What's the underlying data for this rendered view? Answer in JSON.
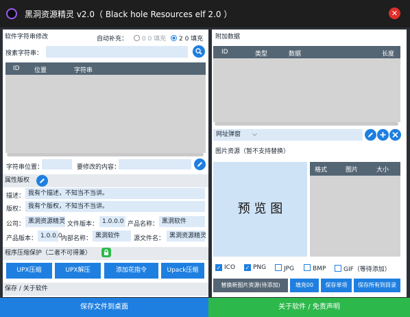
{
  "window": {
    "title": "黑洞资源精灵 v2.0（ Black hole Resources elf 2.0 ）",
    "close_glyph": "✕"
  },
  "strings": {
    "section": "软件字符串修改",
    "auto_fill_label": "自动补充：",
    "fill_00": "0 0 填充",
    "fill_20": "2 0 填充",
    "search_label": "搜素字符串：",
    "search_value": "",
    "columns": [
      "ID",
      "位置",
      "字符串"
    ],
    "pos_label": "字符串位置：",
    "pos_value": "",
    "edit_label": "要修改的内容：",
    "edit_value": ""
  },
  "props": {
    "section": "属性版权",
    "desc_label": "描述：",
    "desc_value": "我有个描述，不知当不当讲。",
    "copyright_label": "版权：",
    "copyright_value": "我有个版权，不知当不当讲。",
    "company_label": "公司：",
    "company_value": "黑洞资源精灵",
    "file_ver_label": "文件版本：",
    "file_ver_value": "1.0.0.0",
    "product_name_label": "产品名称：",
    "product_name_value": "黑洞软件",
    "product_ver_label": "产品版本：",
    "product_ver_value": "1.0.0.0",
    "internal_name_label": "内部名称：",
    "internal_name_value": "黑洞软件",
    "source_name_label": "源文件名：",
    "source_name_value": "黑洞资源精灵"
  },
  "compress": {
    "section": "程序压缩保护（二者不可得兼）",
    "buttons": [
      "UPX压缩",
      "UPX解压",
      "添加花指令",
      "Upack压缩"
    ]
  },
  "about": {
    "section": "保存 / 关于软件"
  },
  "attach": {
    "section": "附加数据",
    "columns": [
      "ID",
      "类型",
      "数据",
      "长度"
    ],
    "dropdown_value": "网址弹窗"
  },
  "images": {
    "section": "图片资源（暂不支持替换）",
    "preview": "预  览  图",
    "columns": [
      "格式",
      "图片",
      "大小"
    ],
    "formats": [
      {
        "label": "ICO",
        "checked": true
      },
      {
        "label": "PNG",
        "checked": true
      },
      {
        "label": "JPG",
        "checked": false
      },
      {
        "label": "BMP",
        "checked": false
      },
      {
        "label": "GIF（等待添加）",
        "checked": false
      }
    ],
    "buttons": [
      "替换新图片资源(待添加)",
      "填充00",
      "保存单项",
      "保存所有到目录"
    ]
  },
  "footer": {
    "save_label": "保存文件到桌面",
    "about_label": "关于软件 / 免责声明"
  },
  "colors": {
    "accent": "#1e7fe0",
    "green": "#2db84b",
    "header": "#546574",
    "titlebar": "#1e1e1e",
    "close": "#e0302a"
  },
  "icons": {
    "logo": "black-hole-logo-icon",
    "search": "search-icon",
    "edit": "pencil-icon",
    "lock": "lock-icon",
    "add": "plus-icon",
    "remove": "close-icon",
    "dropdown": "chevron-down-icon"
  }
}
